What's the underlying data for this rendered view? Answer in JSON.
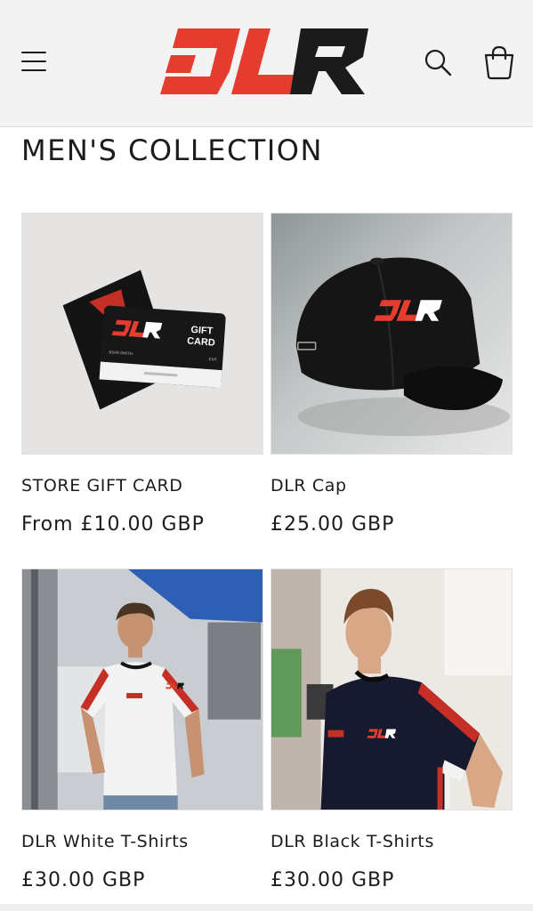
{
  "brand": {
    "logo_text": "DLR",
    "accent_color": "#e43d2f",
    "dark_color": "#1b1b1b"
  },
  "header": {
    "menu_icon": "hamburger-icon",
    "search_icon": "search-icon",
    "cart_icon": "cart-icon"
  },
  "collection": {
    "title": "MEN'S COLLECTION",
    "products": [
      {
        "name": "STORE GIFT CARD",
        "price": "From £10.00 GBP",
        "card_text": {
          "gift": "GIFT",
          "card": "CARD",
          "holder": "JOHN SMITH",
          "exp": "EXP."
        }
      },
      {
        "name": "DLR Cap",
        "price": "£25.00 GBP"
      },
      {
        "name": "DLR White T-Shirts",
        "price": "£30.00 GBP"
      },
      {
        "name": "DLR Black T-Shirts",
        "price": "£30.00 GBP"
      }
    ]
  }
}
